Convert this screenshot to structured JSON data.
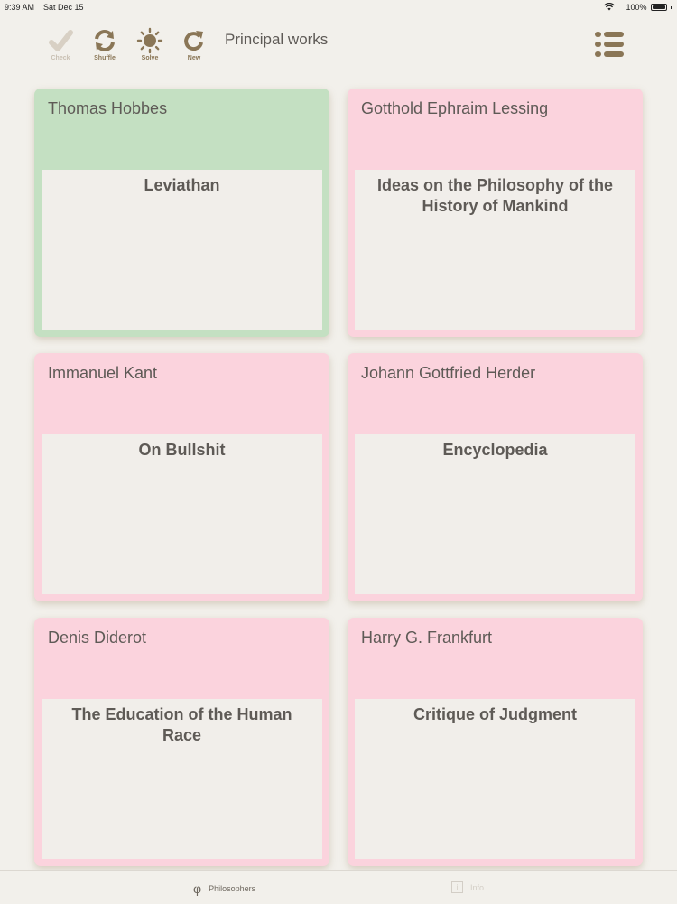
{
  "status": {
    "time": "9:39 AM",
    "date": "Sat Dec 15",
    "battery": "100%"
  },
  "toolbar": {
    "check_label": "Check",
    "shuffle_label": "Shuffle",
    "solve_label": "Solve",
    "new_label": "New",
    "title": "Principal works"
  },
  "cards": [
    {
      "name": "Thomas Hobbes",
      "work": "Leviathan",
      "state": "correct"
    },
    {
      "name": "Gotthold Ephraim Lessing",
      "work": "Ideas on the Philosophy of the History of Mankind",
      "state": "incorrect"
    },
    {
      "name": "Immanuel Kant",
      "work": "On Bullshit",
      "state": "incorrect"
    },
    {
      "name": "Johann Gottfried Herder",
      "work": "Encyclopedia",
      "state": "incorrect"
    },
    {
      "name": "Denis Diderot",
      "work": "The Education of the Human Race",
      "state": "incorrect"
    },
    {
      "name": "Harry G. Frankfurt",
      "work": "Critique of Judgment",
      "state": "incorrect"
    }
  ],
  "tabs": [
    {
      "label": "Philosophers",
      "glyph": "φ",
      "active": true
    },
    {
      "label": "Info",
      "active": false
    }
  ],
  "colors": {
    "correct": "#c4e0c2",
    "incorrect": "#fbd3dd",
    "accent": "#8a7656",
    "background": "#f2f0eb"
  }
}
